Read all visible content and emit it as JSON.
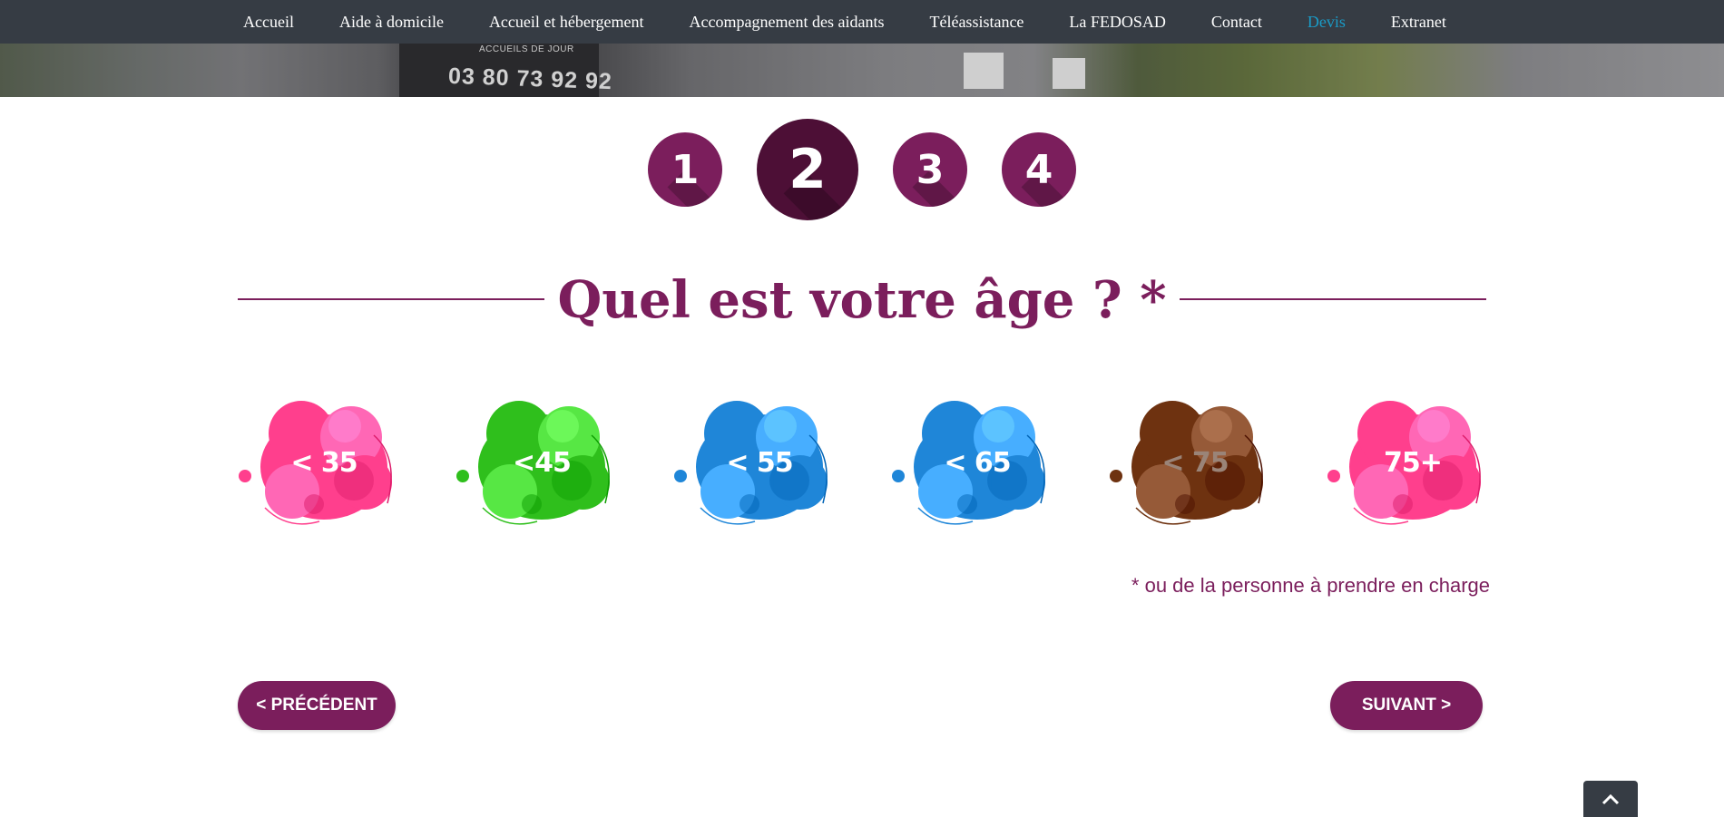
{
  "nav": {
    "items": [
      {
        "label": "Accueil",
        "active": false
      },
      {
        "label": "Aide à domicile",
        "active": false
      },
      {
        "label": "Accueil et hébergement",
        "active": false
      },
      {
        "label": "Accompagnement des aidants",
        "active": false
      },
      {
        "label": "Téléassistance",
        "active": false
      },
      {
        "label": "La FEDOSAD",
        "active": false
      },
      {
        "label": "Contact",
        "active": false
      },
      {
        "label": "Devis",
        "active": true
      },
      {
        "label": "Extranet",
        "active": false
      }
    ],
    "active_color": "#1a9bc7"
  },
  "hero": {
    "sign_small": "ACCUEILS DE JOUR",
    "phone": "03 80 73 92 92"
  },
  "steps": {
    "items": [
      "1",
      "2",
      "3",
      "4"
    ],
    "current": 2
  },
  "question": {
    "title": "Quel est votre âge ? *",
    "footnote": "* ou de la personne à prendre en charge"
  },
  "age_options": [
    {
      "label": "< 35",
      "color": "#ff3f8d"
    },
    {
      "label": "<45",
      "color": "#2fbf1c"
    },
    {
      "label": "< 55",
      "color": "#1f86d8"
    },
    {
      "label": "< 65",
      "color": "#1f86d8"
    },
    {
      "label": "< 75",
      "color": "#6e3210"
    },
    {
      "label": "75+",
      "color": "#ff3f8d"
    }
  ],
  "buttons": {
    "previous": "< PRÉCÉDENT",
    "next": "SUIVANT >"
  },
  "colors": {
    "brand": "#7b1e5c",
    "nav_bg": "#363c44"
  },
  "back_to_top_icon": "chevron-up-icon"
}
